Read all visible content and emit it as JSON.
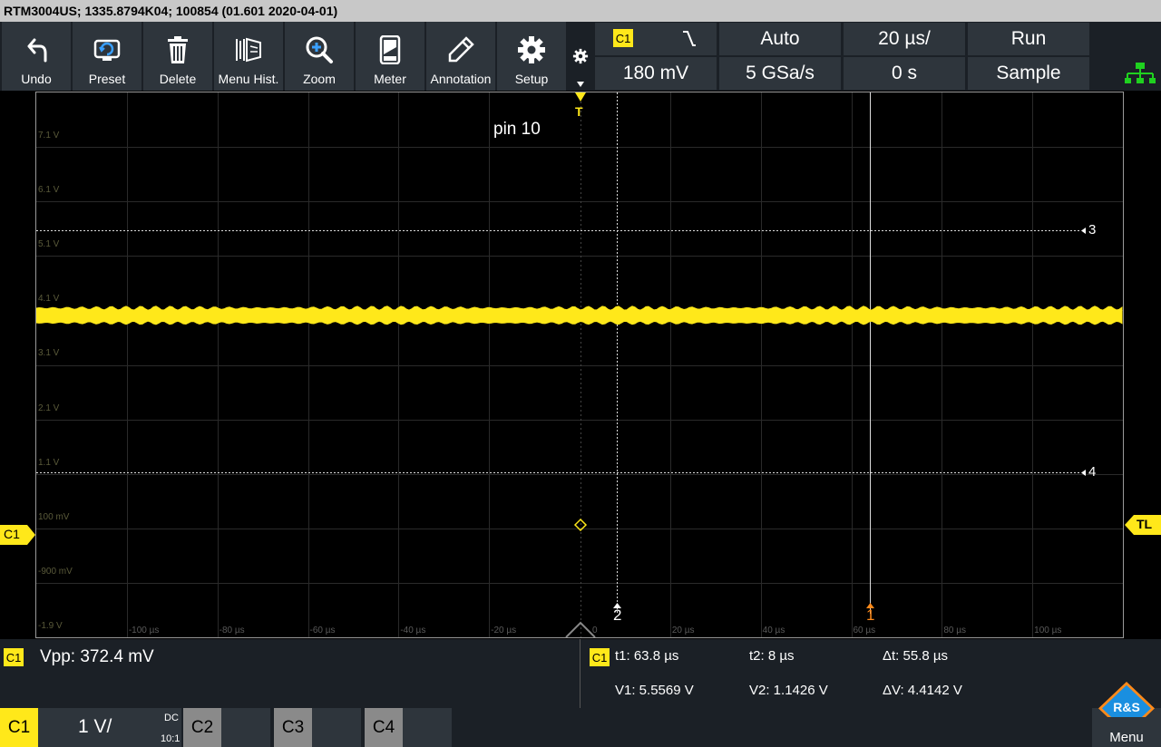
{
  "title": "RTM3004US; 1335.8794K04; 100854 (01.601 2020-04-01)",
  "toolbar": {
    "undo": "Undo",
    "preset": "Preset",
    "delete": "Delete",
    "menu_hist": "Menu Hist.",
    "zoom": "Zoom",
    "meter": "Meter",
    "annotation": "Annotation",
    "setup": "Setup"
  },
  "status": {
    "trigger_source": "C1",
    "trigger_level": "180 mV",
    "trigger_mode": "Auto",
    "sample_rate": "5 GSa/s",
    "timebase": "20 µs/",
    "position": "0 s",
    "run_state": "Run",
    "acq_mode": "Sample"
  },
  "grid": {
    "annotation": "pin 10",
    "trigger_marker": "T",
    "volt_labels": [
      "7.1 V",
      "6.1 V",
      "5.1 V",
      "4.1 V",
      "3.1 V",
      "2.1 V",
      "1.1 V",
      "100 mV",
      "-900 mV",
      "-1.9 V"
    ],
    "time_labels": [
      "-100 µs",
      "-80 µs",
      "-60 µs",
      "-40 µs",
      "-20 µs",
      "0",
      "20 µs",
      "40 µs",
      "60 µs",
      "80 µs",
      "100 µs"
    ],
    "cursor_h3": "3",
    "cursor_h4": "4",
    "cursor_v1": "1",
    "cursor_v2": "2",
    "channel_marker": "C1",
    "trigger_level_marker": "TL"
  },
  "measurement": {
    "channel": "C1",
    "vpp": "Vpp: 372.4 mV",
    "cursor_channel": "C1",
    "t1": "t1: 63.8 µs",
    "t2": "t2: 8 µs",
    "dt": "Δt: 55.8 µs",
    "v1": "V1: 5.5569 V",
    "v2": "V2: 1.1426 V",
    "dv": "ΔV: 4.4142 V"
  },
  "channels": {
    "c1": "C1",
    "c1_scale": "1 V/",
    "c1_coupling": "DC",
    "c1_probe": "10:1",
    "c2": "C2",
    "c3": "C3",
    "c4": "C4"
  },
  "menu_label": "Menu",
  "logo_text": "R&S",
  "colors": {
    "ch1": "#ffe81a",
    "cursor_orange": "#ff8a1a",
    "toolbar_bg": "#2e353c",
    "lan_green": "#1fd11f"
  }
}
